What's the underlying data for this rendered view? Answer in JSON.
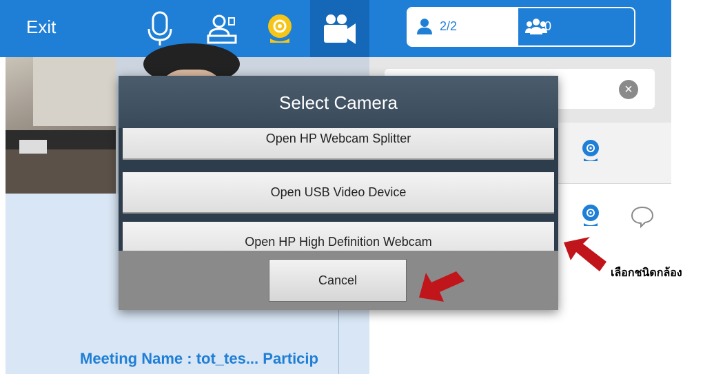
{
  "topbar": {
    "exit_label": "Exit",
    "icons": [
      "microphone-icon",
      "presenter-icon",
      "webcam-icon",
      "video-camera-icon"
    ],
    "attendees_count": "2/2",
    "groups_count": "0"
  },
  "dialog": {
    "title": "Select Camera",
    "options": [
      "Open HP Webcam Splitter",
      "Open USB Video Device",
      "Open HP High Definition Webcam"
    ],
    "cancel_label": "Cancel"
  },
  "meeting": {
    "name_line": "Meeting Name :  tot_tes... Particip"
  },
  "annotation": {
    "text": "เลือกชนิดกล้อง"
  },
  "colors": {
    "accent": "#1f7fd6",
    "accent_dark": "#1568b8",
    "dialog_header": "#3f5060",
    "arrow": "#c0151a",
    "webcam_yellow": "#f5c518"
  }
}
